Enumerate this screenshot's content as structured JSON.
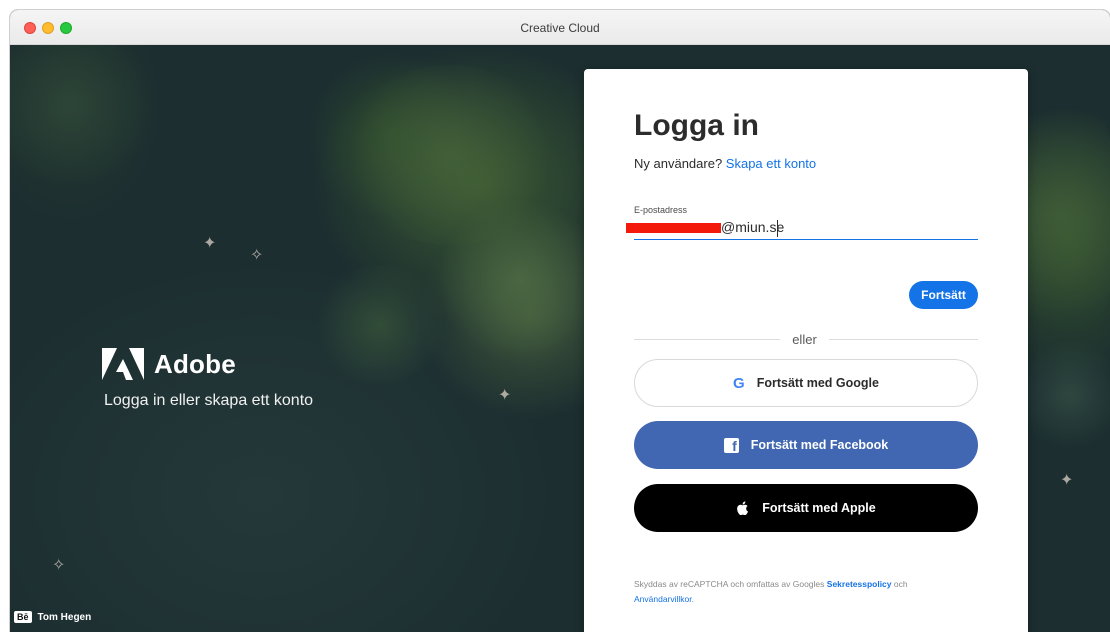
{
  "window": {
    "title": "Creative Cloud"
  },
  "hero": {
    "brand_name": "Adobe",
    "tagline": "Logga in eller skapa ett konto",
    "credit_badge": "Bē",
    "credit_name": "Tom Hegen"
  },
  "login": {
    "title": "Logga in",
    "new_user_text": "Ny användare?",
    "create_account_link": "Skapa ett konto",
    "email_label": "E-postadress",
    "email_value": "@miun.se",
    "continue_button": "Fortsätt",
    "or_text": "eller",
    "google_button": "Fortsätt med Google",
    "facebook_button": "Fortsätt med Facebook",
    "apple_button": "Fortsätt med Apple",
    "legal_prefix": "Skyddas av reCAPTCHA och omfattas av Googles",
    "privacy_link": "Sekretesspolicy",
    "legal_and": "och",
    "terms_link": "Användarvillkor",
    "legal_suffix": "."
  },
  "colors": {
    "accent": "#1473e6",
    "facebook": "#4267b2",
    "apple": "#000000",
    "redaction": "#f41a0b"
  },
  "icons": {
    "google": "google-icon",
    "facebook": "facebook-icon",
    "apple": "apple-icon",
    "adobe": "adobe-logo-icon"
  }
}
